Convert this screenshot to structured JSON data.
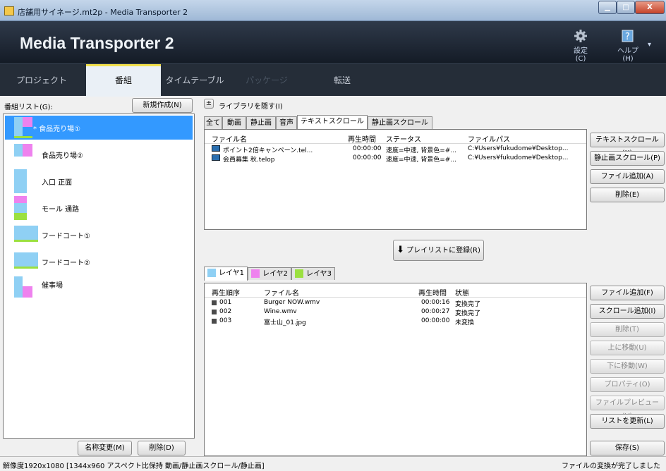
{
  "window": {
    "title": "店舗用サイネージ.mt2p - Media Transporter 2",
    "min": "",
    "max": "",
    "close": "X"
  },
  "header": {
    "app_title": "Media Transporter 2",
    "settings_label": "設定(C)",
    "help_label": "ヘルプ(H)"
  },
  "nav": {
    "items": [
      "プロジェクト",
      "番組",
      "タイムテーブル",
      "パッケージ",
      "転送"
    ]
  },
  "left": {
    "list_label": "番組リスト(G):",
    "new_button": "新規作成(N)",
    "programs": [
      {
        "name": "* 食品売り場①"
      },
      {
        "name": "食品売り場②"
      },
      {
        "name": "入口 正面"
      },
      {
        "name": "モール 通路"
      },
      {
        "name": "フードコート①"
      },
      {
        "name": "フードコート②"
      },
      {
        "name": "催事場"
      }
    ],
    "rename_button": "名称変更(M)",
    "delete_button": "削除(D)"
  },
  "library": {
    "toggle_button": "±",
    "toggle_label": "ライブラリを隠す(I)",
    "tabs": [
      "全て",
      "動画",
      "静止画",
      "音声",
      "テキストスクロール",
      "静止画スクロール"
    ],
    "columns": [
      "ファイル名",
      "再生時間",
      "ステータス",
      "ファイルパス"
    ],
    "rows": [
      {
        "name": "ポイント2倍キャンペーン.tel...",
        "time": "00:00:00",
        "status": "速度=中速, 背景色=#...",
        "path": "C:¥Users¥fukudome¥Desktop..."
      },
      {
        "name": "会員募集 秋.telop",
        "time": "00:00:00",
        "status": "速度=中速, 背景色=#...",
        "path": "C:¥Users¥fukudome¥Desktop..."
      }
    ],
    "side_buttons": [
      "テキストスクロール(X)",
      "静止画スクロール(P)",
      "ファイル追加(A)",
      "削除(E)"
    ]
  },
  "register_button": "プレイリストに登録(R)",
  "layers": {
    "tabs": [
      "レイヤ1",
      "レイヤ2",
      "レイヤ3"
    ],
    "columns": [
      "再生順序",
      "ファイル名",
      "再生時間",
      "状態"
    ],
    "rows": [
      {
        "order": "001",
        "name": "Burger NOW.wmv",
        "time": "00:00:16",
        "state": "変換完了"
      },
      {
        "order": "002",
        "name": "Wine.wmv",
        "time": "00:00:27",
        "state": "変換完了"
      },
      {
        "order": "003",
        "name": "富士山_01.jpg",
        "time": "00:00:00",
        "state": "未変換"
      }
    ],
    "side_buttons": [
      "ファイル追加(F)",
      "スクロール追加(I)",
      "削除(T)",
      "上に移動(U)",
      "下に移動(W)",
      "プロパティ(O)",
      "ファイルプレビュー(V)",
      "リストを更新(L)"
    ]
  },
  "save_button": "保存(S)",
  "status": {
    "left": "解像度1920x1080  [1344x960 アスペクト比保持 動画/静止画スクロール/静止画]",
    "right": "ファイルの変換が完了しました"
  },
  "colors": {
    "layer1": "#8fd0f4",
    "layer2": "#ee82ee",
    "layer3": "#9be040",
    "accent": "#f2e04c",
    "selection": "#3399ff"
  }
}
